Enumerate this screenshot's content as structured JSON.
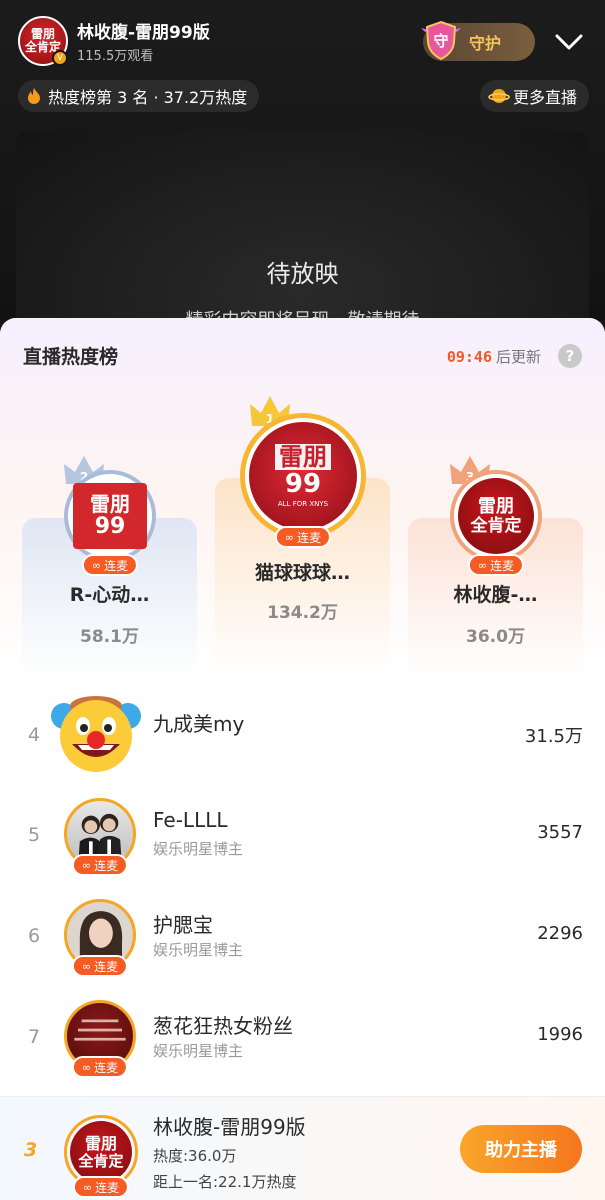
{
  "header": {
    "host_name": "林收腹-雷朋99版",
    "views": "115.5万观看",
    "guard_label": "守护",
    "hot_rank": "热度榜第 3 名 · 37.2万热度",
    "more_live": "更多直播"
  },
  "video": {
    "status": "待放映",
    "subtitle": "精彩内容即将呈现，敬请期待"
  },
  "board": {
    "title": "直播热度榜",
    "countdown": "09:46",
    "countdown_suffix": "后更新",
    "help": "?",
    "link_label": "连麦",
    "podium": [
      {
        "rank": "1",
        "name": "猫球球球…",
        "score": "134.2万"
      },
      {
        "rank": "2",
        "name": "R-心动…",
        "score": "58.1万"
      },
      {
        "rank": "3",
        "name": "林收腹-…",
        "score": "36.0万"
      }
    ],
    "list": [
      {
        "rank": "4",
        "name": "九成美my",
        "subtitle": "",
        "score": "31.5万"
      },
      {
        "rank": "5",
        "name": "Fe-LLLL",
        "subtitle": "娱乐明星博主",
        "score": "3557"
      },
      {
        "rank": "6",
        "name": "护腮宝",
        "subtitle": "娱乐明星博主",
        "score": "2296"
      },
      {
        "rank": "7",
        "name": "葱花狂热女粉丝",
        "subtitle": "娱乐明星博主",
        "score": "1996"
      }
    ]
  },
  "my_rank": {
    "rank": "3",
    "name": "林收腹-雷朋99版",
    "heat": "热度:36.0万",
    "gap": "距上一名:22.1万热度",
    "boost_label": "助力主播"
  },
  "avatar_text": {
    "brand": "雷朋",
    "brand_line2": "全肯定",
    "ninety_nine": "99",
    "all_for": "ALL FOR XNYS"
  },
  "colors": {
    "accent": "#f55b23",
    "gold": "#f5a623",
    "countdown": "#f05a28"
  }
}
